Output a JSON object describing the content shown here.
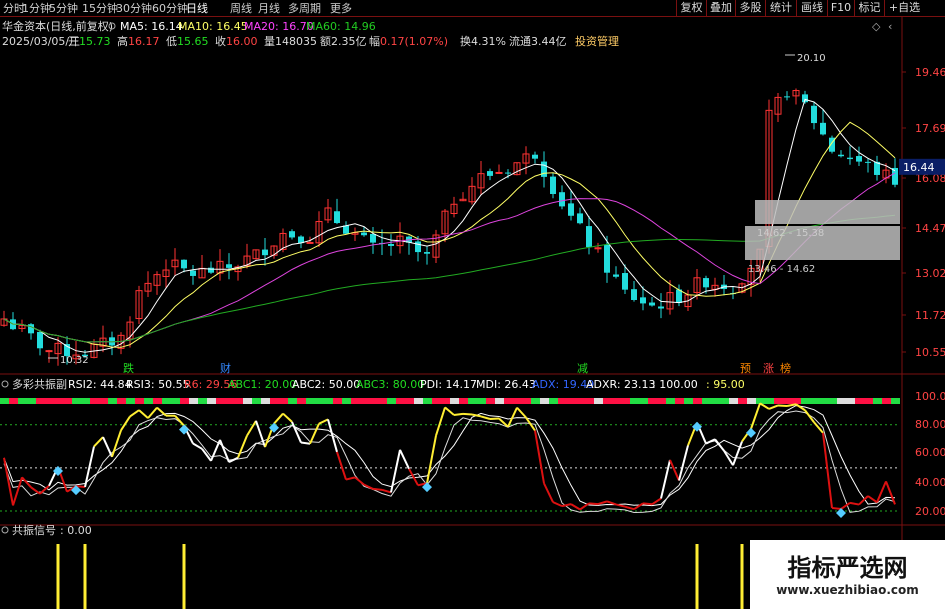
{
  "toolbar": {
    "periods": [
      "分时",
      "1分钟",
      "5分钟",
      "15分钟",
      "30分钟",
      "60分钟",
      "日线",
      "周线",
      "月线",
      "多周期",
      "更多"
    ],
    "active_period": "日线",
    "buttons": [
      "复权",
      "叠加",
      "多股",
      "统计",
      "画线",
      "F10",
      "标记",
      "+自选"
    ]
  },
  "header": {
    "title": "华金资本(日线,前复权)",
    "ma": [
      {
        "label": "MA5: 16.14",
        "color": "#ffffff"
      },
      {
        "label": "MA10: 16.45",
        "color": "#ffff66"
      },
      {
        "label": "MA20: 16.70",
        "color": "#ff44ff"
      },
      {
        "label": "MA60: 14.96",
        "color": "#22cc22"
      }
    ],
    "date": "2025/03/05/三",
    "quote": [
      {
        "label": "开",
        "value": "15.73",
        "color": "#22dd22"
      },
      {
        "label": "高",
        "value": "16.17",
        "color": "#ff4444"
      },
      {
        "label": "低",
        "value": "15.65",
        "color": "#22dd22"
      },
      {
        "label": "收",
        "value": "16.00",
        "color": "#ff4444"
      },
      {
        "label": "量",
        "value": "148035",
        "color": "#dddddd"
      },
      {
        "label": "额",
        "value": "2.35亿",
        "color": "#dddddd"
      },
      {
        "label": "幅",
        "value": "0.17(1.07%)",
        "color": "#ff4444"
      },
      {
        "label": "换",
        "value": "4.31%",
        "color": "#dddddd"
      },
      {
        "label": "流通",
        "value": "3.44亿",
        "color": "#dddddd"
      }
    ],
    "manage": "投资管理"
  },
  "price_axis": [
    "19.46",
    "17.69",
    "16.08",
    "14.47",
    "13.02",
    "11.72",
    "10.55"
  ],
  "current_price": "16.44",
  "annotations": {
    "high": "20.10",
    "low": "10.32",
    "box_mid": "14.62 - 15.38",
    "box_low": "13.46 - 14.62"
  },
  "signal_labels": [
    {
      "text": "跌",
      "color": "#22dd22"
    },
    {
      "text": "财",
      "color": "#3388ff"
    },
    {
      "text": "减",
      "color": "#22dd22"
    },
    {
      "text": "预",
      "color": "#ff8800"
    },
    {
      "text": "涨",
      "color": "#ff4444"
    },
    {
      "text": "榜",
      "color": "#ff8800"
    }
  ],
  "indicator": {
    "name": "多彩共振副",
    "values": [
      {
        "label": "RSI2: 44.84",
        "color": "#ffffff"
      },
      {
        "label": "RSI3: 50.55",
        "color": "#ffffff"
      },
      {
        "label": "R6: 29.56",
        "color": "#ff4444"
      },
      {
        "label": "ABC1: 20.00",
        "color": "#22dd22"
      },
      {
        "label": "ABC2: 50.00",
        "color": "#ffffff"
      },
      {
        "label": "ABC3: 80.00",
        "color": "#22dd22"
      },
      {
        "label": "PDI: 14.17",
        "color": "#ffffff"
      },
      {
        "label": "MDI: 26.43",
        "color": "#ffffff"
      },
      {
        "label": "ADX: 19.49",
        "color": "#3366ff"
      },
      {
        "label": "ADXR: 23.13",
        "color": "#ffffff"
      },
      {
        "label": ": 100.00",
        "color": "#ffffff"
      },
      {
        "label": ": 95.00",
        "color": "#ffff66"
      }
    ],
    "axis": [
      "100.00",
      "80.00",
      "60.00",
      "40.00",
      "20.00"
    ]
  },
  "signal_panel": {
    "name": "共振信号",
    "value": ": 0.00"
  },
  "watermark": {
    "title": "指标严选网",
    "url": "www.xuezhibiao.com"
  },
  "colors": {
    "up": "#ff3333",
    "down": "#22dddd",
    "ma5": "#ffffff",
    "ma10": "#ffff66",
    "ma20": "#dd44dd",
    "ma60": "#22aa22",
    "border": "#7a1010"
  }
}
